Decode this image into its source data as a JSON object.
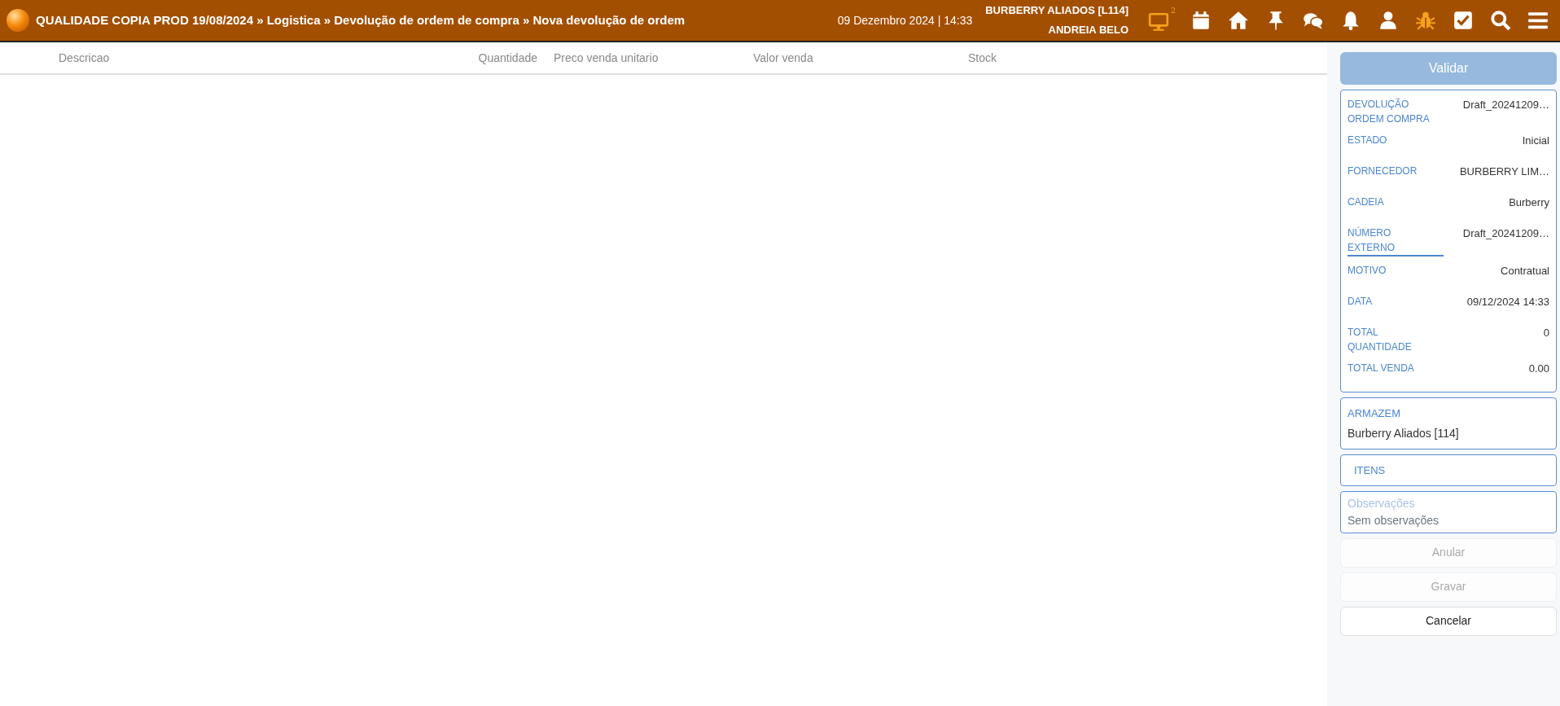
{
  "header": {
    "breadcrumb": "QUALIDADE COPIA PROD 19/08/2024 » Logistica » Devolução de ordem de compra » Nova devolução de ordem",
    "datetime": "09 Dezembro 2024 | 14:33",
    "store": "BURBERRY ALIADOS [L114]",
    "user": "ANDREIA BELO",
    "icons": [
      {
        "kind": "monitor",
        "highlighted": true,
        "badge": "2"
      },
      {
        "kind": "calendar",
        "highlighted": false
      },
      {
        "kind": "home",
        "highlighted": false
      },
      {
        "kind": "pin",
        "highlighted": false
      },
      {
        "kind": "chat",
        "highlighted": false
      },
      {
        "kind": "bell",
        "highlighted": false
      },
      {
        "kind": "user",
        "highlighted": false
      },
      {
        "kind": "bug",
        "highlighted": true
      },
      {
        "kind": "check",
        "highlighted": false
      },
      {
        "kind": "search",
        "highlighted": false
      },
      {
        "kind": "menu",
        "highlighted": false
      }
    ]
  },
  "table": {
    "columns": [
      "Descricao",
      "Quantidade",
      "Preco venda unitario",
      "Valor venda",
      "Stock"
    ]
  },
  "sidebar": {
    "validate_button": {
      "label": "Validar",
      "disabled": true
    },
    "details": [
      {
        "label": "DEVOLUÇÃO ORDEM COMPRA",
        "value": "Draft_20241209…",
        "selected": false
      },
      {
        "label": "ESTADO",
        "value": "Inicial",
        "selected": false
      },
      {
        "label": "FORNECEDOR",
        "value": "BURBERRY LIM…",
        "selected": false
      },
      {
        "label": "CADEIA",
        "value": "Burberry",
        "selected": false
      },
      {
        "label": "NÚMERO EXTERNO",
        "value": "Draft_20241209…",
        "selected": true
      },
      {
        "label": "MOTIVO",
        "value": "Contratual",
        "selected": false
      },
      {
        "label": "DATA",
        "value": "09/12/2024 14:33",
        "selected": false
      },
      {
        "label": "TOTAL QUANTIDADE",
        "value": "0",
        "selected": false
      },
      {
        "label": "TOTAL VENDA",
        "value": "0.00",
        "selected": false
      }
    ],
    "warehouse": {
      "label": "ARMAZEM",
      "value": "Burberry Aliados [114]"
    },
    "items": {
      "label": "ITENS"
    },
    "notes": {
      "label": "Observações",
      "value": "Sem observações"
    },
    "buttons": [
      {
        "label": "Anular",
        "disabled": true
      },
      {
        "label": "Gravar",
        "disabled": true
      },
      {
        "label": "Cancelar",
        "disabled": false
      }
    ]
  }
}
